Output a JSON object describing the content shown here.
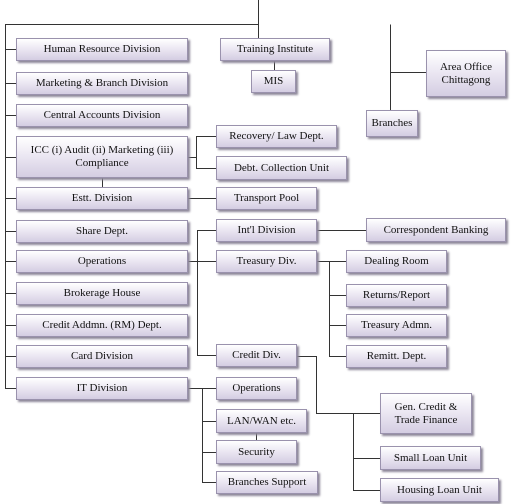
{
  "colors": {
    "box_top": "#ffffff",
    "box_bottom": "#d4cde2",
    "border": "#9a92ad",
    "line": "#333333"
  },
  "left_column": [
    "Human Resource Division",
    "Marketing & Branch Division",
    "Central Accounts Division",
    "ICC (i) Audit (ii) Marketing (iii) Compliance",
    "Estt. Division",
    "Share Dept.",
    "Operations",
    "Brokerage House",
    "Credit Addmn. (RM) Dept.",
    "Card Division",
    "IT Division"
  ],
  "top": {
    "training": "Training Institute",
    "mis": "MIS",
    "area_office": "Area Office Chittagong",
    "branches": "Branches"
  },
  "icc_children": [
    "Recovery/ Law Dept.",
    "Debt. Collection Unit"
  ],
  "estt_children": [
    "Transport Pool"
  ],
  "operations_children": [
    "Int'l Division",
    "Treasury Div.",
    "Credit Div."
  ],
  "intl_children": [
    "Correspondent Banking"
  ],
  "treasury_children": [
    "Dealing Room",
    "Returns/Report",
    "Treasury Admn.",
    "Remitt. Dept."
  ],
  "credit_children": [
    "Gen. Credit & Trade Finance",
    "Small Loan Unit",
    "Housing Loan Unit"
  ],
  "it_children": [
    "Operations",
    "LAN/WAN etc.",
    "Security",
    "Branches Support"
  ]
}
